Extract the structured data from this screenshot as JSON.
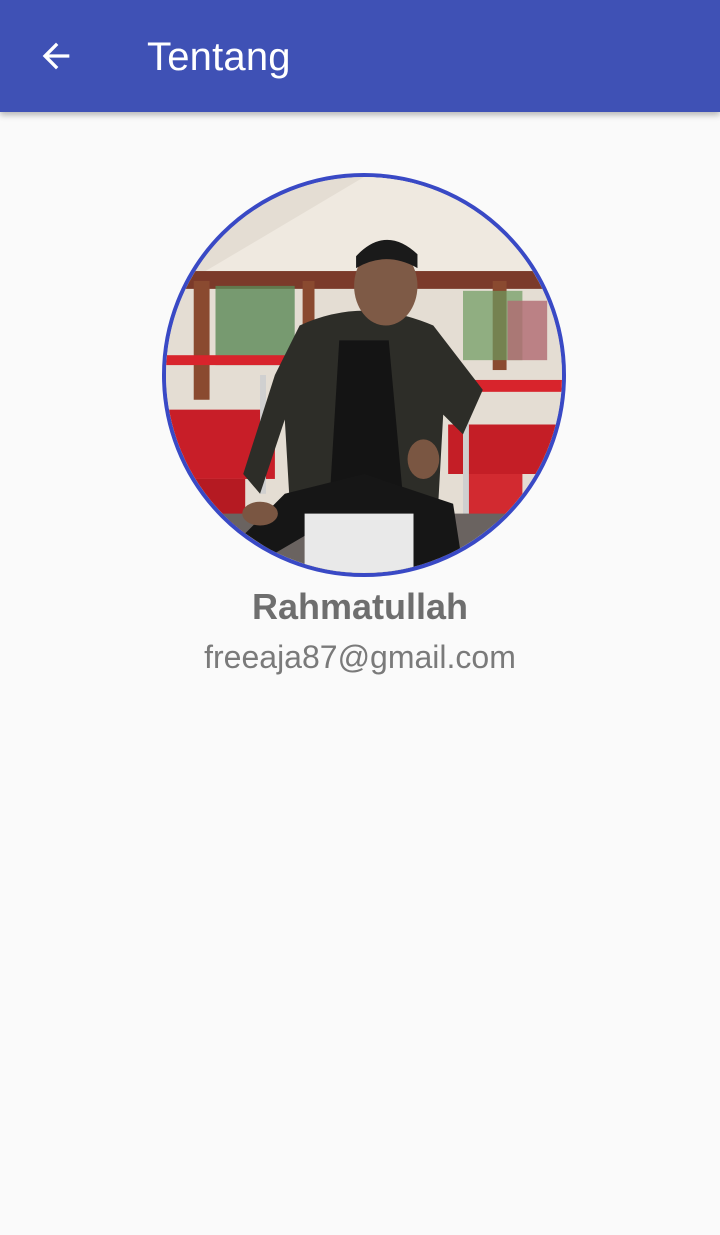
{
  "appbar": {
    "title": "Tentang",
    "back_icon": "arrow-left-icon",
    "color": "#3f51b5"
  },
  "profile": {
    "avatar": "profile-photo",
    "ring_color": "#3949c5",
    "name": "Rahmatullah",
    "email": "freeaja87@gmail.com"
  }
}
